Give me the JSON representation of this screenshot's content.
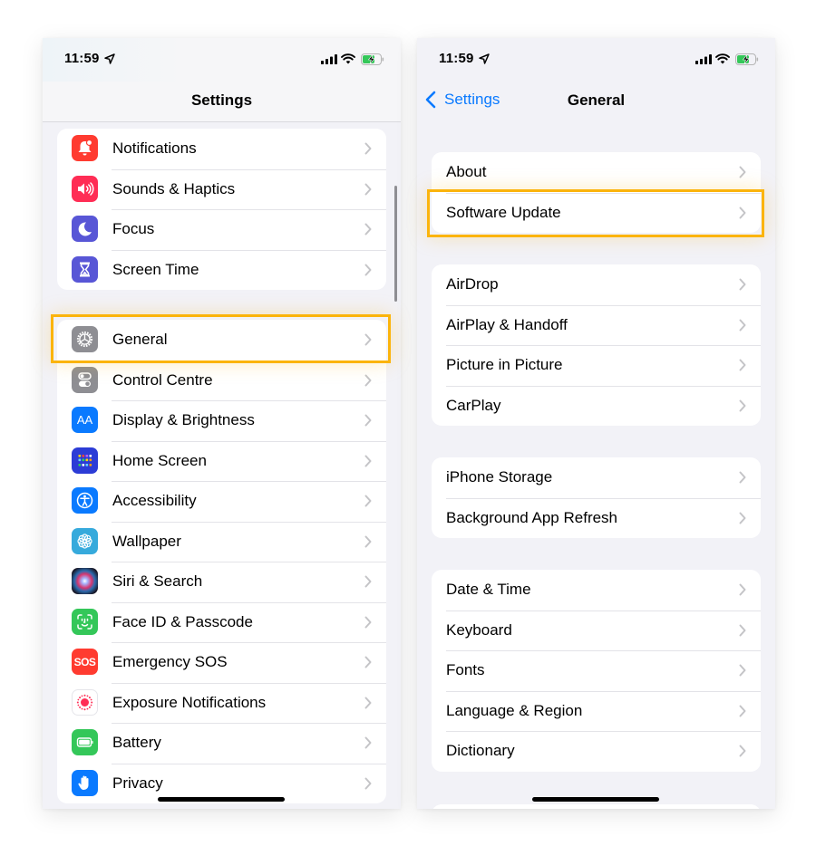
{
  "status_bar": {
    "time": "11:59",
    "icons": [
      "location-arrow-icon",
      "cellular-signal-icon",
      "wifi-icon",
      "battery-charging-icon"
    ]
  },
  "colors": {
    "highlight": "#fbb40c",
    "ios_blue": "#0a7aff",
    "background": "#f2f2f7"
  },
  "left_screen": {
    "title": "Settings",
    "groups": [
      {
        "items": [
          {
            "label": "Notifications",
            "icon": "bell-icon",
            "icon_color": "#ff3b30"
          },
          {
            "label": "Sounds & Haptics",
            "icon": "speaker-icon",
            "icon_color": "#ff2d55"
          },
          {
            "label": "Focus",
            "icon": "moon-icon",
            "icon_color": "#5856d6"
          },
          {
            "label": "Screen Time",
            "icon": "hourglass-icon",
            "icon_color": "#5856d6"
          }
        ]
      },
      {
        "items": [
          {
            "label": "General",
            "icon": "gear-icon",
            "icon_color": "#8e8e93",
            "highlighted": true
          },
          {
            "label": "Control Centre",
            "icon": "toggles-icon",
            "icon_color": "#8e8e93"
          },
          {
            "label": "Display & Brightness",
            "icon": "text-size-icon",
            "icon_color": "#0a7aff"
          },
          {
            "label": "Home Screen",
            "icon": "app-grid-icon",
            "icon_color": "#2c3cd6"
          },
          {
            "label": "Accessibility",
            "icon": "accessibility-icon",
            "icon_color": "#0a7aff"
          },
          {
            "label": "Wallpaper",
            "icon": "flower-icon",
            "icon_color": "#36aadc"
          },
          {
            "label": "Siri & Search",
            "icon": "siri-icon",
            "icon_color": "#1c1c1e"
          },
          {
            "label": "Face ID & Passcode",
            "icon": "face-id-icon",
            "icon_color": "#34c759"
          },
          {
            "label": "Emergency SOS",
            "icon": "sos-icon",
            "icon_color": "#ff3b30"
          },
          {
            "label": "Exposure Notifications",
            "icon": "exposure-icon",
            "icon_color": "#ffffff"
          },
          {
            "label": "Battery",
            "icon": "battery-icon",
            "icon_color": "#34c759"
          },
          {
            "label": "Privacy",
            "icon": "hand-icon",
            "icon_color": "#0a7aff"
          }
        ]
      }
    ],
    "sos_text": "SOS",
    "aa_text": "AA"
  },
  "right_screen": {
    "back_label": "Settings",
    "title": "General",
    "groups": [
      {
        "items": [
          {
            "label": "About"
          },
          {
            "label": "Software Update",
            "highlighted": true
          }
        ]
      },
      {
        "items": [
          {
            "label": "AirDrop"
          },
          {
            "label": "AirPlay & Handoff"
          },
          {
            "label": "Picture in Picture"
          },
          {
            "label": "CarPlay"
          }
        ]
      },
      {
        "items": [
          {
            "label": "iPhone Storage"
          },
          {
            "label": "Background App Refresh"
          }
        ]
      },
      {
        "items": [
          {
            "label": "Date & Time"
          },
          {
            "label": "Keyboard"
          },
          {
            "label": "Fonts"
          },
          {
            "label": "Language & Region"
          },
          {
            "label": "Dictionary"
          }
        ]
      }
    ]
  }
}
